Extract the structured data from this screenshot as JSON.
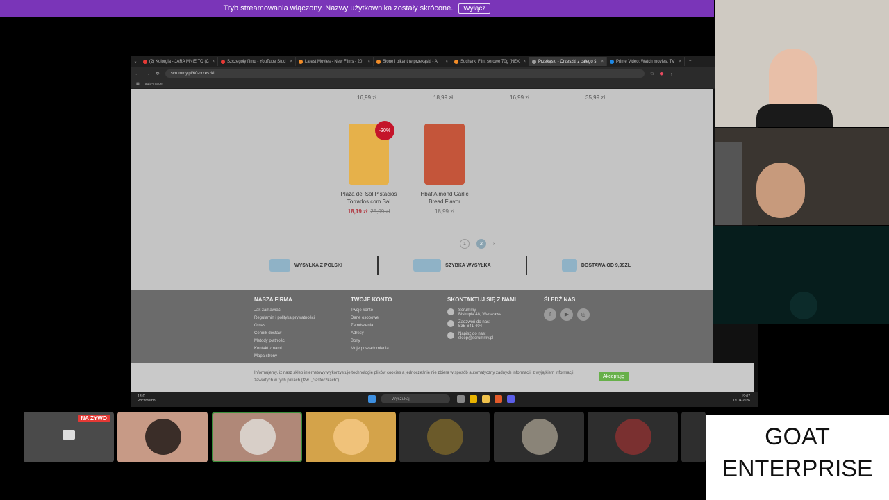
{
  "stream_banner": {
    "text": "Tryb streamowania włączony. Nazwy użytkownika zostały skrócone.",
    "button": "Wyłącz"
  },
  "browser": {
    "tabs": [
      {
        "title": "(2) Kolorgia - JARA MNIE TO (C",
        "color": "#e53935"
      },
      {
        "title": "Szczegóły filmu - YouTube Stud",
        "color": "#e53935"
      },
      {
        "title": "Latest Movies - New Films - 20",
        "color": "#f28c28"
      },
      {
        "title": "Słone i pikantne przekąski - Al",
        "color": "#f28c28"
      },
      {
        "title": "Sucharki Flint serowe 70g (NEX",
        "color": "#f28c28"
      },
      {
        "title": "Przekąski - Orzeszki z całego ś",
        "color": "#9e9e9e"
      },
      {
        "title": "Prime Video: Watch movies, TV",
        "color": "#1e88e5"
      }
    ],
    "active_tab": 5,
    "url": "scrummy.pl/60-orzeszki",
    "bookmark": "auto-image"
  },
  "shop": {
    "top_prices": [
      "16,99 zł",
      "18,99 zł",
      "16,99 zł",
      "35,99 zł"
    ],
    "products": [
      {
        "name_line1": "Plaza del Sol Pistácios",
        "name_line2": "Torrados com Sal",
        "price": "18,19 zł",
        "old_price": "25,99 zł",
        "discount": "-30%",
        "color": "#e6b14a"
      },
      {
        "name_line1": "Hbaf Almond Garlic",
        "name_line2": "Bread Flavor",
        "price": "18,99 zł",
        "color": "#c4553a"
      }
    ],
    "pagination": {
      "pages": [
        "1",
        "2"
      ],
      "current": "2",
      "next": "›"
    },
    "features": [
      "WYSYŁKA Z POLSKI",
      "SZYBKA WYSYŁKA",
      "DOSTAWA OD 9,99ZŁ"
    ],
    "footer": {
      "col1": {
        "title": "NASZA FIRMA",
        "links": [
          "Jak zamawiać",
          "Regulamin i polityka prywatności",
          "O nas",
          "Cennik dostaw",
          "Metody płatności",
          "Kontakt z nami",
          "Mapa strony"
        ]
      },
      "col2": {
        "title": "TWOJE KONTO",
        "links": [
          "Twoje konto",
          "Dane osobowe",
          "Zamówienia",
          "Adresy",
          "Bony",
          "Moje powiadomienia"
        ]
      },
      "col3": {
        "title": "SKONTAKTUJ SIĘ Z NAMI",
        "address_1": "Scrummy",
        "address_2": "Biskupia 48, Warszawa",
        "phone_label": "Zadzwoń do nas:",
        "phone": "535-641-404",
        "email_label": "Napisz do nas:",
        "email": "sklep@scrummy.pl"
      },
      "col4": {
        "title": "ŚLEDŹ NAS",
        "icons": [
          "f",
          "▶",
          "◎"
        ]
      }
    },
    "cookie": {
      "text": "Informujemy, iż nasz sklep internetowy wykorzystuje technologię plików cookies a jednocześnie nie zbiera w sposób automatyczny żadnych informacji, z wyjątkiem informacji zawartych w tych plikach (tzw. „ciasteczkach\").",
      "button": "Akceptuję"
    }
  },
  "taskbar": {
    "weather_temp": "13°C",
    "weather_desc": "Pochmurno",
    "search": "Wyszukaj",
    "time": "19:07",
    "date": "19.04.2026"
  },
  "participants": {
    "live_badge": "NA ŻYWO"
  },
  "overlay_text": {
    "line1": "GOAT",
    "line2": "ENTERPRISE"
  }
}
